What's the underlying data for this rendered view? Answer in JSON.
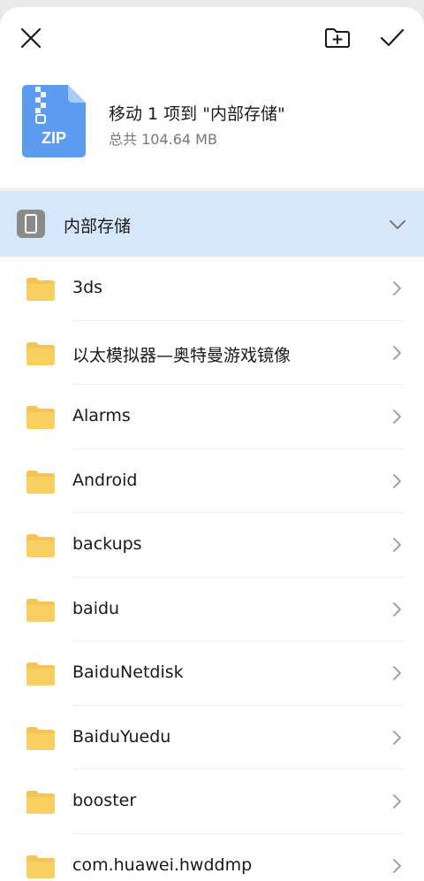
{
  "toolbar": {
    "close_icon": "close-icon",
    "new_folder_icon": "new-folder-icon",
    "confirm_icon": "check-icon"
  },
  "move_info": {
    "file_type": "ZIP",
    "title": "移动 1 项到 \"内部存储\"",
    "size": "总共 104.64 MB"
  },
  "location": {
    "label": "内部存储",
    "icon": "phone-icon",
    "accent": "#d6e6fb"
  },
  "folders": [
    {
      "name": "3ds"
    },
    {
      "name": "以太模拟器—奥特曼游戏镜像"
    },
    {
      "name": "Alarms"
    },
    {
      "name": "Android"
    },
    {
      "name": "backups"
    },
    {
      "name": "baidu"
    },
    {
      "name": "BaiduNetdisk"
    },
    {
      "name": "BaiduYuedu"
    },
    {
      "name": "booster"
    },
    {
      "name": "com.huawei.hwddmp"
    }
  ],
  "colors": {
    "folder": "#f5c451",
    "zip": "#5b9cf0"
  }
}
